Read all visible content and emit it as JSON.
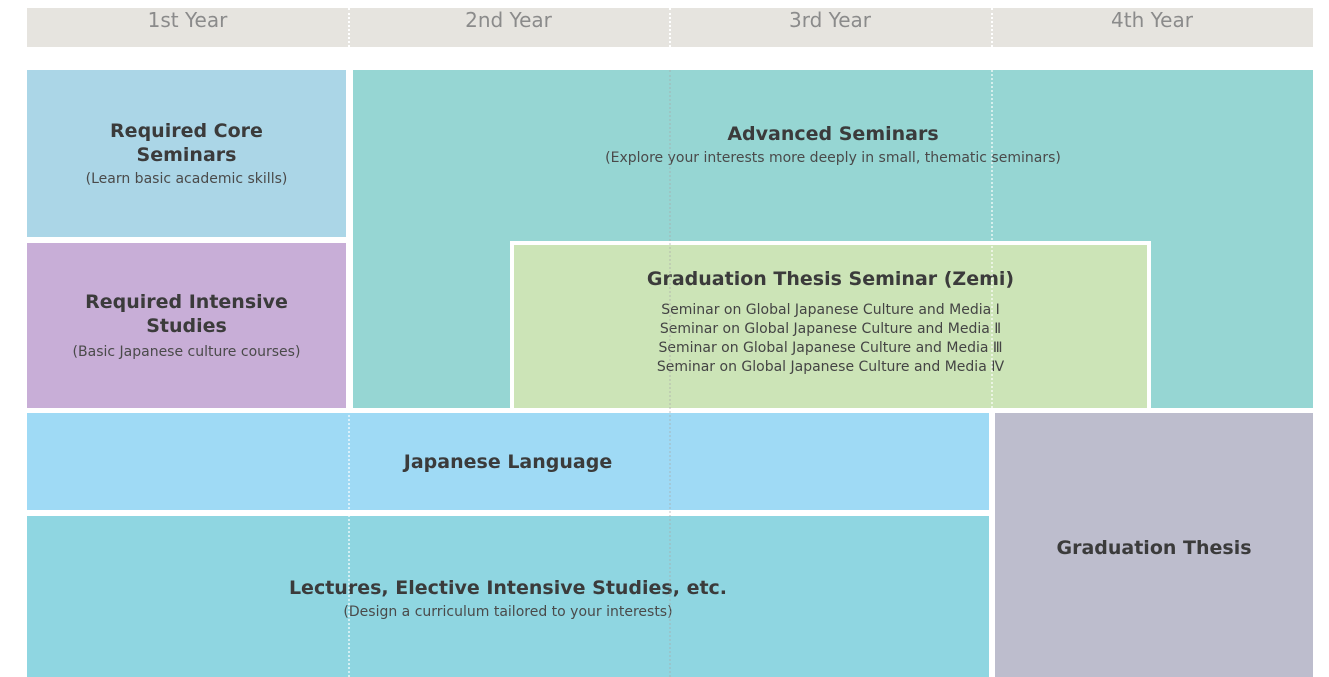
{
  "years": [
    "1st Year",
    "2nd Year",
    "3rd Year",
    "4th Year"
  ],
  "blocks": {
    "core": {
      "title": "Required Core\nSeminars",
      "subtitle": "(Learn basic academic skills)"
    },
    "intensive": {
      "title": "Required Intensive\nStudies",
      "subtitle": "(Basic Japanese culture courses)"
    },
    "advanced": {
      "title": "Advanced Seminars",
      "subtitle": "(Explore your interests more deeply in small, thematic seminars)"
    },
    "thesis_seminar": {
      "title": "Graduation Thesis Seminar (Zemi)",
      "courses": [
        "Seminar on Global Japanese Culture and Media Ⅰ",
        "Seminar on Global Japanese Culture and Media Ⅱ",
        "Seminar on Global Japanese Culture and Media Ⅲ",
        "Seminar on Global Japanese Culture and Media Ⅳ"
      ]
    },
    "japanese": {
      "title": "Japanese Language"
    },
    "lectures": {
      "title": "Lectures, Elective Intensive Studies, etc.",
      "subtitle": "(Design a curriculum tailored to your interests)"
    },
    "graduation_thesis": {
      "title": "Graduation Thesis"
    }
  },
  "colors": {
    "header": "#e6e4df",
    "core": "#abd6e7",
    "intensive": "#c8aed7",
    "advanced": "#96d6d3",
    "thesis_seminar": "#cce4b7",
    "japanese": "#9fdaf5",
    "lectures": "#8fd6e1",
    "graduation_thesis": "#bdbdcd"
  }
}
